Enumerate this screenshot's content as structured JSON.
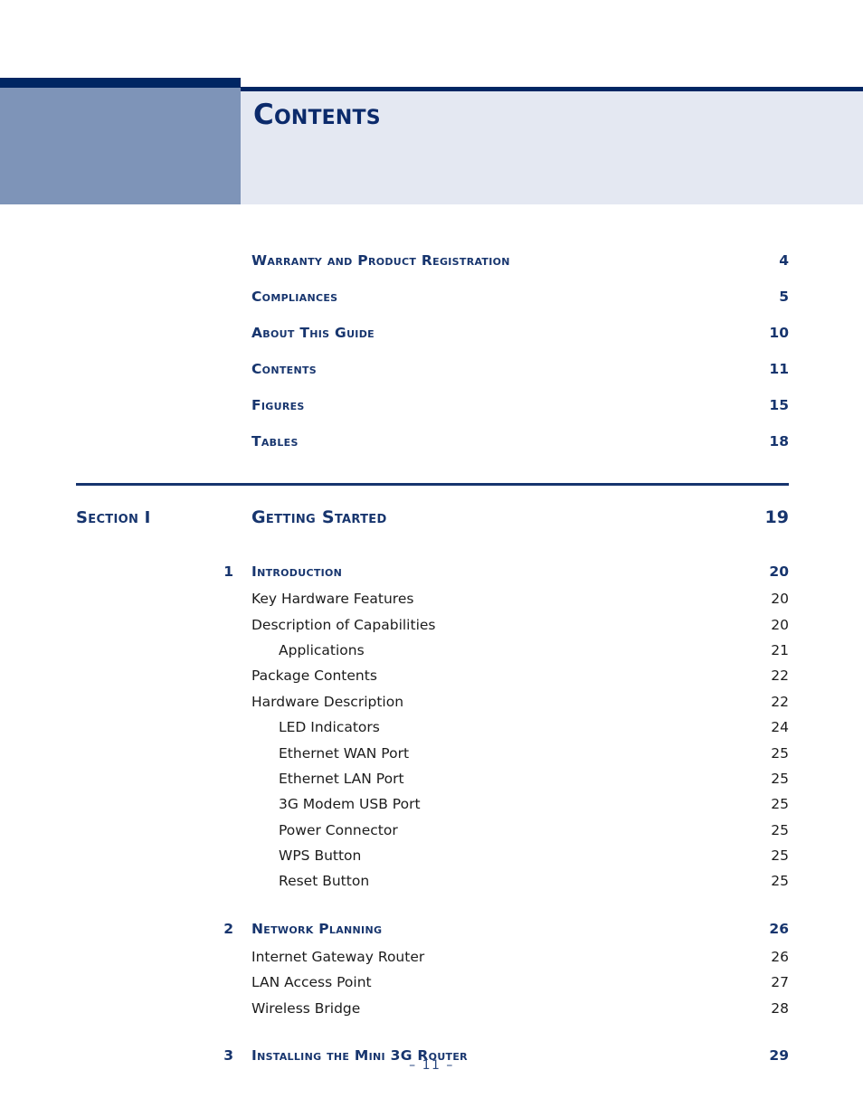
{
  "page": {
    "title": "Contents",
    "footer": "–  11  –"
  },
  "colors": {
    "navy_dark": "#002663",
    "navy_text": "#17356e",
    "slate_block": "#7e94b8",
    "panel_bg": "#e4e8f2",
    "body_text": "#1c1c1c"
  },
  "front_matter": [
    {
      "label": "Warranty and Product Registration",
      "page": "4"
    },
    {
      "label": "Compliances",
      "page": "5"
    },
    {
      "label": "About This Guide",
      "page": "10"
    },
    {
      "label": "Contents",
      "page": "11"
    },
    {
      "label": "Figures",
      "page": "15"
    },
    {
      "label": "Tables",
      "page": "18"
    }
  ],
  "section": {
    "tag": "Section I",
    "label": "Getting Started",
    "page": "19"
  },
  "chapters": [
    {
      "number": "1",
      "label": "Introduction",
      "page": "20",
      "entries": [
        {
          "level": 2,
          "label": "Key Hardware Features",
          "page": "20"
        },
        {
          "level": 2,
          "label": "Description of Capabilities",
          "page": "20"
        },
        {
          "level": 3,
          "label": "Applications",
          "page": "21"
        },
        {
          "level": 2,
          "label": "Package Contents",
          "page": "22"
        },
        {
          "level": 2,
          "label": "Hardware Description",
          "page": "22"
        },
        {
          "level": 3,
          "label": "LED Indicators",
          "page": "24"
        },
        {
          "level": 3,
          "label": "Ethernet WAN Port",
          "page": "25"
        },
        {
          "level": 3,
          "label": "Ethernet LAN Port",
          "page": "25"
        },
        {
          "level": 3,
          "label": "3G Modem USB Port",
          "page": "25"
        },
        {
          "level": 3,
          "label": "Power Connector",
          "page": "25"
        },
        {
          "level": 3,
          "label": "WPS Button",
          "page": "25"
        },
        {
          "level": 3,
          "label": "Reset Button",
          "page": "25"
        }
      ]
    },
    {
      "number": "2",
      "label": "Network Planning",
      "page": "26",
      "entries": [
        {
          "level": 2,
          "label": "Internet Gateway Router",
          "page": "26"
        },
        {
          "level": 2,
          "label": "LAN Access Point",
          "page": "27"
        },
        {
          "level": 2,
          "label": "Wireless Bridge",
          "page": "28"
        }
      ]
    },
    {
      "number": "3",
      "label": "Installing the Mini 3G Router",
      "page": "29",
      "entries": []
    }
  ]
}
